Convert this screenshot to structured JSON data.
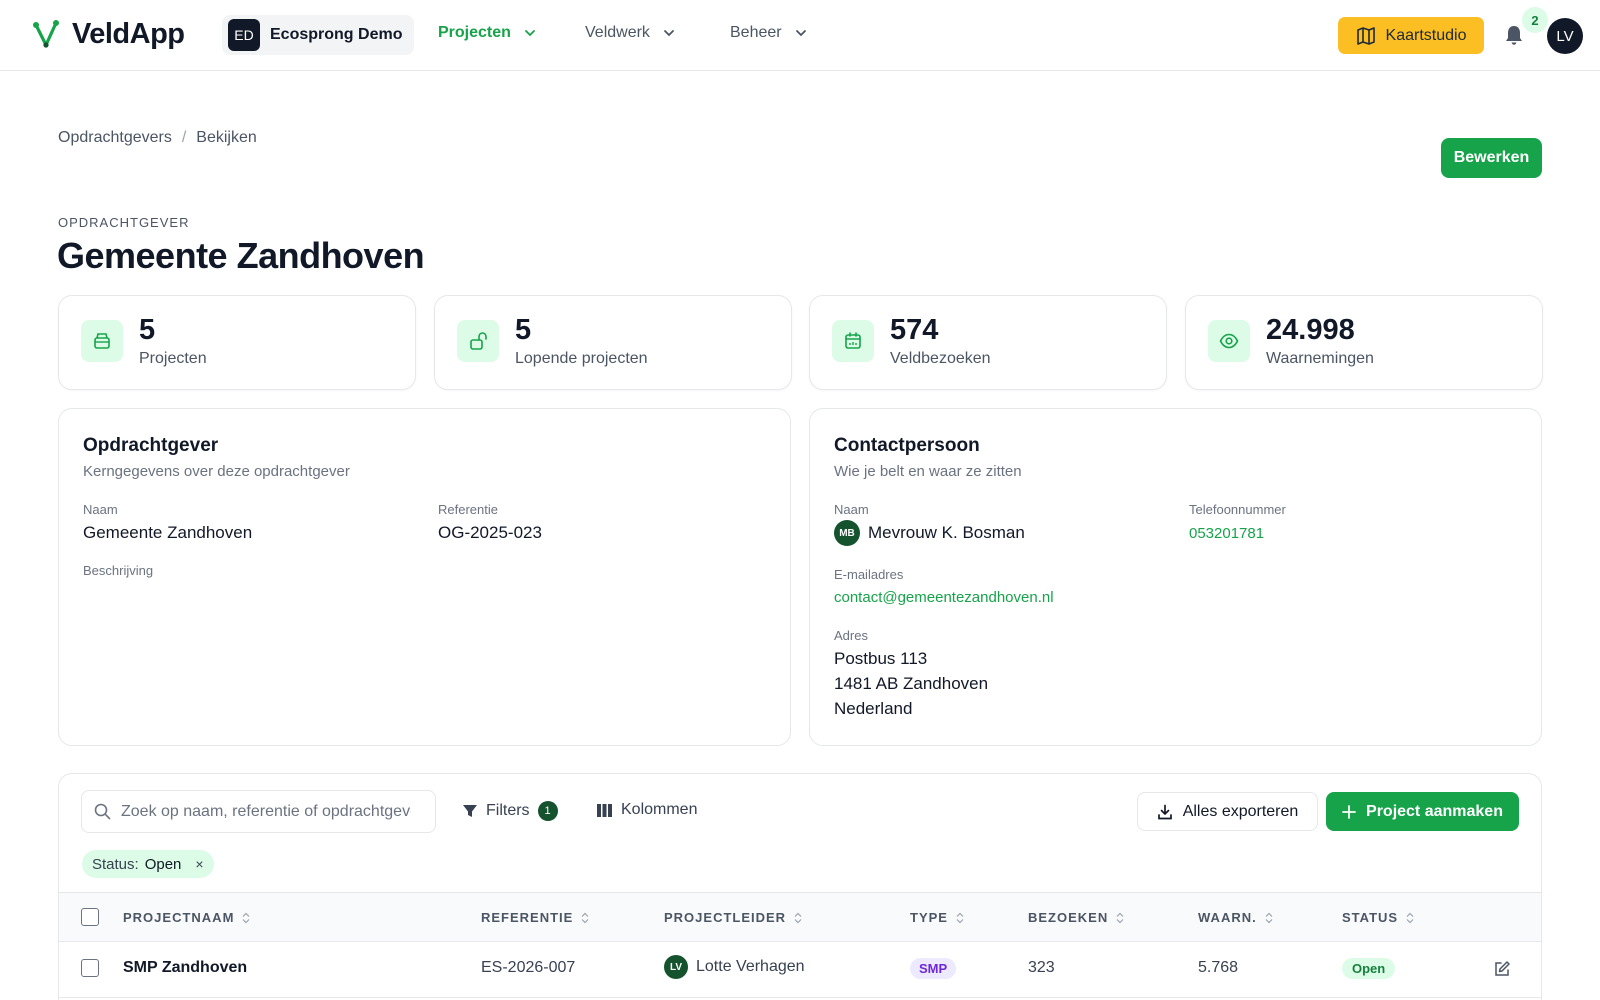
{
  "app": {
    "name": "VeldApp"
  },
  "org": {
    "initials": "ED",
    "name": "Ecosprong Demo"
  },
  "nav": [
    {
      "label": "Projecten",
      "active": true
    },
    {
      "label": "Veldwerk",
      "active": false
    },
    {
      "label": "Beheer",
      "active": false
    }
  ],
  "topbar": {
    "kaartstudio_label": "Kaartstudio",
    "notification_count": "2",
    "user_initials": "LV"
  },
  "breadcrumb": {
    "parent": "Opdrachtgevers",
    "separator": "/",
    "current": "Bekijken"
  },
  "header": {
    "eyebrow": "OPDRACHTGEVER",
    "title": "Gemeente Zandhoven",
    "edit_label": "Bewerken"
  },
  "stats": [
    {
      "value": "5",
      "label": "Projecten",
      "icon": "archive-icon"
    },
    {
      "value": "5",
      "label": "Lopende projecten",
      "icon": "unlock-icon"
    },
    {
      "value": "574",
      "label": "Veldbezoeken",
      "icon": "calendar-icon"
    },
    {
      "value": "24.998",
      "label": "Waarnemingen",
      "icon": "eye-icon"
    }
  ],
  "client_card": {
    "title": "Opdrachtgever",
    "subtitle": "Kerngegevens over deze opdrachtgever",
    "name_label": "Naam",
    "name_value": "Gemeente Zandhoven",
    "ref_label": "Referentie",
    "ref_value": "OG-2025-023",
    "desc_label": "Beschrijving"
  },
  "contact_card": {
    "title": "Contactpersoon",
    "subtitle": "Wie je belt en waar ze zitten",
    "name_label": "Naam",
    "initials": "MB",
    "name_value": "Mevrouw K. Bosman",
    "phone_label": "Telefoonnummer",
    "phone_value": "053201781",
    "email_label": "E-mailadres",
    "email_value": "contact@gemeentezandhoven.nl",
    "address_label": "Adres",
    "address_line1": "Postbus 113",
    "address_line2": "1481 AB Zandhoven",
    "address_line3": "Nederland"
  },
  "table": {
    "search_placeholder": "Zoek op naam, referentie of opdrachtgever",
    "filters_label": "Filters",
    "filters_count": "1",
    "columns_label": "Kolommen",
    "export_label": "Alles exporteren",
    "create_label": "Project aanmaken",
    "chip_key": "Status:",
    "chip_value": "Open",
    "chip_remove": "×",
    "headers": [
      "PROJECTNAAM",
      "REFERENTIE",
      "PROJECTLEIDER",
      "TYPE",
      "BEZOEKEN",
      "WAARN.",
      "STATUS"
    ],
    "rows": [
      {
        "name": "SMP Zandhoven",
        "reference": "ES-2026-007",
        "leader_initials": "LV",
        "leader": "Lotte Verhagen",
        "type": "SMP",
        "visits": "323",
        "observations": "5.768",
        "status": "Open"
      }
    ]
  },
  "colors": {
    "accent": "#16a34a",
    "accent_light": "#dcfce7",
    "kaart": "#fbbf24",
    "type_badge": "#ede9fe"
  }
}
